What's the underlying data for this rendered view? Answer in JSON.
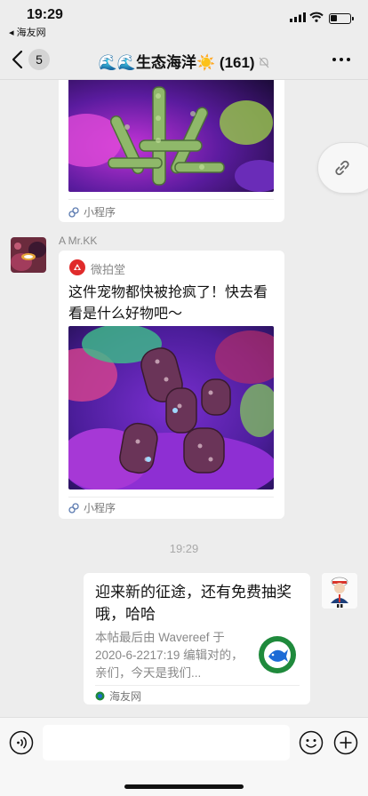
{
  "status_bar": {
    "time": "19:29",
    "back_app": "◂ 海友网"
  },
  "nav": {
    "unread_count": "5",
    "title_waves": "🌊🌊",
    "title_name": "生态海洋",
    "title_sun": "☀️",
    "member_count": "(161)"
  },
  "messages": {
    "top_card": {
      "source_label": "小程序"
    },
    "mrkk_card": {
      "sender": "A  Mr.KK",
      "app_name": "微拍堂",
      "title": "这件宠物都快被抢疯了！快去看看是什么好物吧～",
      "source_label": "小程序"
    },
    "timestamp": "19:29",
    "my_card": {
      "title": "迎来新的征途，还有免费抽奖哦，哈哈",
      "desc": "本帖最后由 Wavereef 于 2020-6-2217:19 编辑对的，亲们，今天是我们...",
      "source_label": "海友网"
    }
  },
  "colors": {
    "background": "#ededed",
    "card": "#ffffff",
    "coral_purple": "#7a2fd0",
    "coral_green": "#6fbf5a"
  }
}
